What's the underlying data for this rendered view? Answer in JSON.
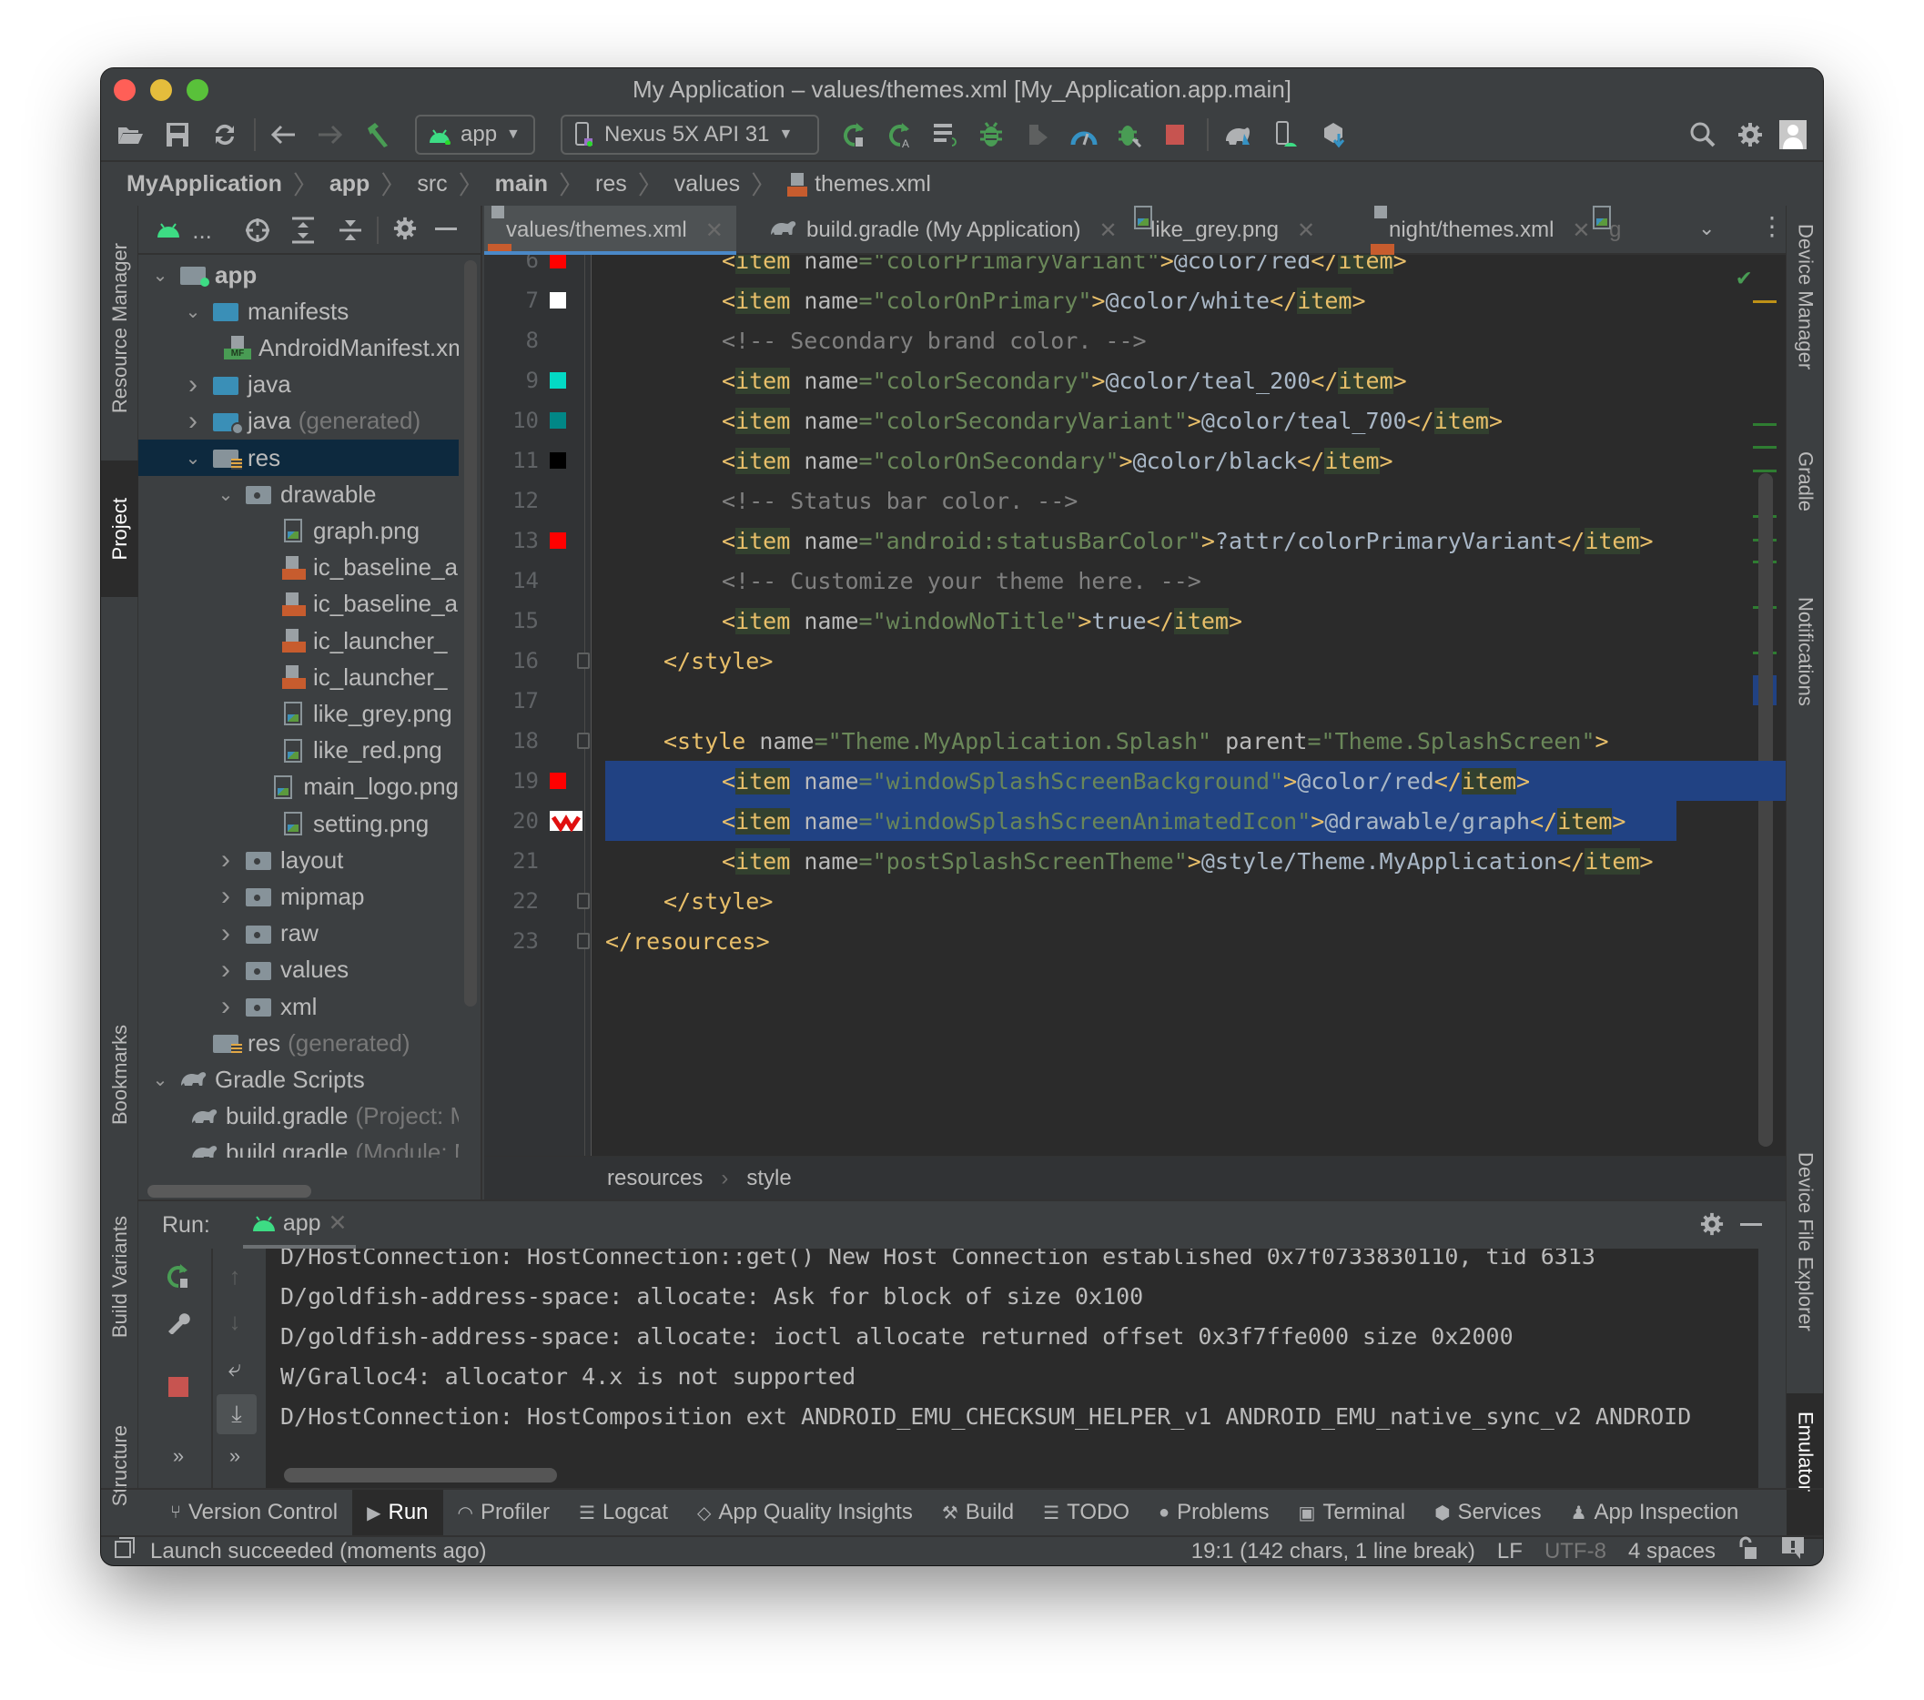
{
  "window": {
    "title": "My Application – values/themes.xml [My_Application.app.main]",
    "traffic_colors": {
      "close": "#ff5f57",
      "minimize": "#e5bd3c",
      "zoom": "#59c13a"
    }
  },
  "toolbar": {
    "run_config": "app",
    "device": "Nexus 5X API 31",
    "icons": [
      "open-folder-icon",
      "save-icon",
      "sync-icon",
      "back-icon",
      "forward-icon",
      "build-hammer-icon",
      "apply-changes-restart-icon",
      "apply-code-changes-icon",
      "apply-changes-icon",
      "debug-icon",
      "profile-icon",
      "profiler-icon",
      "attach-debugger-icon",
      "stop-icon",
      "gradle-sync-icon",
      "device-manager-icon",
      "sdk-manager-icon",
      "search-icon",
      "settings-icon",
      "account-icon"
    ]
  },
  "navbar": {
    "crumbs": [
      {
        "label": "MyApplication",
        "bold": true
      },
      {
        "label": "app",
        "bold": true
      },
      {
        "label": "src",
        "bold": false
      },
      {
        "label": "main",
        "bold": true
      },
      {
        "label": "res",
        "bold": false
      },
      {
        "label": "values",
        "bold": false
      },
      {
        "label": "themes.xml",
        "bold": false
      }
    ]
  },
  "left_strip": {
    "tabs": [
      {
        "label": "Resource Manager",
        "active": false
      },
      {
        "label": "Project",
        "active": true
      },
      {
        "label": "Bookmarks",
        "active": false
      },
      {
        "label": "Build Variants",
        "active": false
      },
      {
        "label": "Structure",
        "active": false
      }
    ]
  },
  "right_strip": {
    "tabs": [
      {
        "label": "Device Manager",
        "active": false
      },
      {
        "label": "Gradle",
        "active": false
      },
      {
        "label": "Notifications",
        "active": false
      },
      {
        "label": "Device File Explorer",
        "active": false
      },
      {
        "label": "Emulator",
        "active": true
      }
    ]
  },
  "project": {
    "view_label": "...",
    "tree": [
      {
        "label": "app",
        "suffix": "",
        "depth": 0,
        "arrow": "down",
        "icon": "module-folder",
        "bold": true,
        "selected": false
      },
      {
        "label": "manifests",
        "suffix": "",
        "depth": 1,
        "arrow": "down",
        "icon": "folder-blue",
        "selected": false
      },
      {
        "label": "AndroidManifest.xml",
        "suffix": "",
        "depth": 2,
        "arrow": "",
        "icon": "manifest",
        "selected": false
      },
      {
        "label": "java",
        "suffix": "",
        "depth": 1,
        "arrow": "right",
        "icon": "folder-blue",
        "selected": false
      },
      {
        "label": "java",
        "suffix": "(generated)",
        "depth": 1,
        "arrow": "right",
        "icon": "folder-generated",
        "selected": false
      },
      {
        "label": "res",
        "suffix": "",
        "depth": 1,
        "arrow": "down",
        "icon": "folder-res",
        "selected": true
      },
      {
        "label": "drawable",
        "suffix": "",
        "depth": 2,
        "arrow": "down",
        "icon": "folder-grey",
        "selected": false
      },
      {
        "label": "graph.png",
        "suffix": "",
        "depth": 3,
        "arrow": "",
        "icon": "png",
        "selected": false
      },
      {
        "label": "ic_baseline_a",
        "suffix": "",
        "depth": 3,
        "arrow": "",
        "icon": "xml",
        "selected": false
      },
      {
        "label": "ic_baseline_a",
        "suffix": "",
        "depth": 3,
        "arrow": "",
        "icon": "xml",
        "selected": false
      },
      {
        "label": "ic_launcher_",
        "suffix": "",
        "depth": 3,
        "arrow": "",
        "icon": "xml",
        "selected": false
      },
      {
        "label": "ic_launcher_",
        "suffix": "",
        "depth": 3,
        "arrow": "",
        "icon": "xml",
        "selected": false
      },
      {
        "label": "like_grey.png",
        "suffix": "",
        "depth": 3,
        "arrow": "",
        "icon": "png",
        "selected": false
      },
      {
        "label": "like_red.png",
        "suffix": "",
        "depth": 3,
        "arrow": "",
        "icon": "png",
        "selected": false
      },
      {
        "label": "main_logo.png",
        "suffix": "",
        "depth": 3,
        "arrow": "",
        "icon": "png",
        "selected": false
      },
      {
        "label": "setting.png",
        "suffix": "",
        "depth": 3,
        "arrow": "",
        "icon": "png",
        "selected": false
      },
      {
        "label": "layout",
        "suffix": "",
        "depth": 2,
        "arrow": "right",
        "icon": "folder-grey",
        "selected": false
      },
      {
        "label": "mipmap",
        "suffix": "",
        "depth": 2,
        "arrow": "right",
        "icon": "folder-grey",
        "selected": false
      },
      {
        "label": "raw",
        "suffix": "",
        "depth": 2,
        "arrow": "right",
        "icon": "folder-grey",
        "selected": false
      },
      {
        "label": "values",
        "suffix": "",
        "depth": 2,
        "arrow": "right",
        "icon": "folder-grey",
        "selected": false
      },
      {
        "label": "xml",
        "suffix": "",
        "depth": 2,
        "arrow": "right",
        "icon": "folder-grey",
        "selected": false
      },
      {
        "label": "res",
        "suffix": "(generated)",
        "depth": 1,
        "arrow": "",
        "icon": "folder-res",
        "selected": false
      },
      {
        "label": "Gradle Scripts",
        "suffix": "",
        "depth": 0,
        "arrow": "down",
        "icon": "gradle",
        "selected": false
      },
      {
        "label": "build.gradle",
        "suffix": "(Project: My_Application)",
        "depth": 1,
        "arrow": "",
        "icon": "gradle",
        "selected": false
      },
      {
        "label": "build.gradle",
        "suffix": "(Module: My_Application.app)",
        "depth": 1,
        "arrow": "",
        "icon": "gradle",
        "selected": false
      }
    ]
  },
  "editor_tabs": [
    {
      "label": "values/themes.xml",
      "icon": "xml",
      "active": true,
      "closable": true
    },
    {
      "label": "build.gradle (My Application)",
      "icon": "gradle",
      "active": false,
      "closable": true
    },
    {
      "label": "like_grey.png",
      "icon": "png",
      "active": false,
      "closable": true
    },
    {
      "label": "night/themes.xml",
      "icon": "xml",
      "active": false,
      "closable": true
    },
    {
      "label": "g",
      "icon": "png",
      "active": false,
      "closable": false
    }
  ],
  "editor": {
    "lines": [
      {
        "n": 6,
        "swatch": "#ff0000",
        "indent": 2,
        "kind": "item",
        "name": "colorPrimaryVariant",
        "value": "@color/red"
      },
      {
        "n": 7,
        "swatch": "#ffffff",
        "indent": 2,
        "kind": "item",
        "name": "colorOnPrimary",
        "value": "@color/white"
      },
      {
        "n": 8,
        "swatch": "",
        "indent": 2,
        "kind": "comment",
        "text": "<!-- Secondary brand color. -->"
      },
      {
        "n": 9,
        "swatch": "#03dac5",
        "indent": 2,
        "kind": "item",
        "name": "colorSecondary",
        "value": "@color/teal_200"
      },
      {
        "n": 10,
        "swatch": "#018786",
        "indent": 2,
        "kind": "item",
        "name": "colorSecondaryVariant",
        "value": "@color/teal_700"
      },
      {
        "n": 11,
        "swatch": "#000000",
        "indent": 2,
        "kind": "item",
        "name": "colorOnSecondary",
        "value": "@color/black"
      },
      {
        "n": 12,
        "swatch": "",
        "indent": 2,
        "kind": "comment",
        "text": "<!-- Status bar color. -->"
      },
      {
        "n": 13,
        "swatch": "#ff0000",
        "indent": 2,
        "kind": "item",
        "name": "android:statusBarColor",
        "value": "?attr/colorPrimaryVariant"
      },
      {
        "n": 14,
        "swatch": "",
        "indent": 2,
        "kind": "comment",
        "text": "<!-- Customize your theme here. -->"
      },
      {
        "n": 15,
        "swatch": "",
        "indent": 2,
        "kind": "item",
        "name": "windowNoTitle",
        "value": "true"
      },
      {
        "n": 16,
        "swatch": "",
        "indent": 1,
        "kind": "close",
        "tag": "style"
      },
      {
        "n": 17,
        "swatch": "",
        "indent": 0,
        "kind": "blank"
      },
      {
        "n": 18,
        "swatch": "",
        "indent": 1,
        "kind": "style-open",
        "name": "Theme.MyApplication.Splash",
        "parent": "Theme.SplashScreen"
      },
      {
        "n": 19,
        "swatch": "#ff0000",
        "indent": 2,
        "kind": "item",
        "name": "windowSplashScreenBackground",
        "value": "@color/red",
        "selected": true
      },
      {
        "n": 20,
        "swatch": "graph",
        "indent": 2,
        "kind": "item",
        "name": "windowSplashScreenAnimatedIcon",
        "value": "@drawable/graph",
        "selected": true
      },
      {
        "n": 21,
        "swatch": "",
        "indent": 2,
        "kind": "item",
        "name": "postSplashScreenTheme",
        "value": "@style/Theme.MyApplication"
      },
      {
        "n": 22,
        "swatch": "",
        "indent": 1,
        "kind": "close",
        "tag": "style"
      },
      {
        "n": 23,
        "swatch": "",
        "indent": 0,
        "kind": "close",
        "tag": "resources"
      }
    ],
    "breadcrumb": [
      "resources",
      "style"
    ],
    "inspection_status": "no-problems"
  },
  "run_panel": {
    "label": "Run:",
    "tab": "app",
    "console": [
      "D/HostConnection: HostConnection::get() New Host Connection established 0x7f0733830110, tid 6313",
      "D/goldfish-address-space: allocate: Ask for block of size 0x100",
      "D/goldfish-address-space: allocate: ioctl allocate returned offset 0x3f7ffe000 size 0x2000",
      "W/Gralloc4: allocator 4.x is not supported",
      "D/HostConnection: HostComposition ext ANDROID_EMU_CHECKSUM_HELPER_v1 ANDROID_EMU_native_sync_v2 ANDROID"
    ]
  },
  "bottom_tabs": [
    {
      "label": "Version Control",
      "icon": "vcs-icon",
      "active": false
    },
    {
      "label": "Run",
      "icon": "run-icon",
      "active": true
    },
    {
      "label": "Profiler",
      "icon": "profiler-icon",
      "active": false
    },
    {
      "label": "Logcat",
      "icon": "logcat-icon",
      "active": false
    },
    {
      "label": "App Quality Insights",
      "icon": "diamond-icon",
      "active": false
    },
    {
      "label": "Build",
      "icon": "hammer-icon",
      "active": false
    },
    {
      "label": "TODO",
      "icon": "list-icon",
      "active": false
    },
    {
      "label": "Problems",
      "icon": "problems-icon",
      "active": false
    },
    {
      "label": "Terminal",
      "icon": "terminal-icon",
      "active": false
    },
    {
      "label": "Services",
      "icon": "services-icon",
      "active": false
    },
    {
      "label": "App Inspection",
      "icon": "inspector-icon",
      "active": false
    }
  ],
  "status_bar": {
    "message": "Launch succeeded (moments ago)",
    "position": "19:1 (142 chars, 1 line break)",
    "line_separator": "LF",
    "encoding": "UTF-8",
    "indent": "4 spaces"
  },
  "colors": {
    "accent": "#4a88c7",
    "selection": "#214283",
    "tree_selection": "#0d293e",
    "tag": "#e8bf6a",
    "string": "#6a8759",
    "comment": "#808080",
    "android_green": "#3ddc84",
    "stop_red": "#c75450"
  }
}
